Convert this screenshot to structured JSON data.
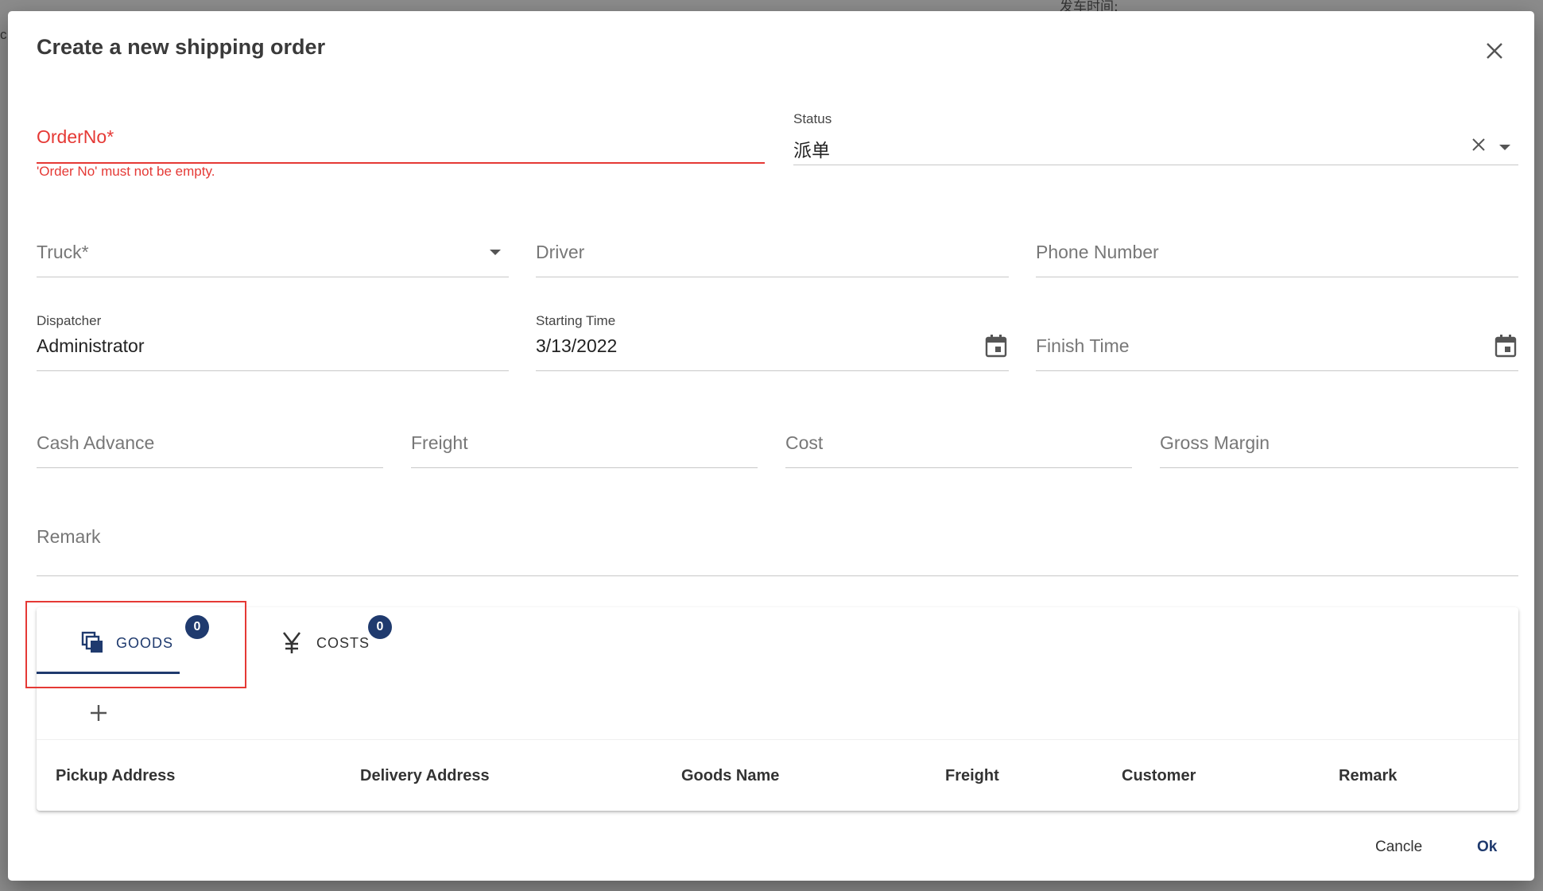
{
  "background": {
    "top_text": "发车时间:",
    "left_text": "c"
  },
  "dialog": {
    "title": "Create a new shipping order"
  },
  "form": {
    "order_no": {
      "label": "OrderNo*",
      "error": "'Order No' must not be empty."
    },
    "status": {
      "label": "Status",
      "value": "派单"
    },
    "truck": {
      "label": "Truck*"
    },
    "driver": {
      "label": "Driver"
    },
    "phone": {
      "label": "Phone Number"
    },
    "dispatcher": {
      "label": "Dispatcher",
      "value": "Administrator"
    },
    "starting_time": {
      "label": "Starting Time",
      "value": "3/13/2022"
    },
    "finish_time": {
      "label": "Finish Time"
    },
    "cash_advance": {
      "label": "Cash Advance"
    },
    "freight": {
      "label": "Freight"
    },
    "cost": {
      "label": "Cost"
    },
    "gross_margin": {
      "label": "Gross Margin"
    },
    "remark": {
      "label": "Remark"
    }
  },
  "tabs": [
    {
      "label": "GOODS",
      "badge": "0",
      "icon": "copy-icon",
      "active": true
    },
    {
      "label": "COSTS",
      "badge": "0",
      "icon": "yen-icon",
      "active": false
    }
  ],
  "table": {
    "columns": [
      "Pickup Address",
      "Delivery Address",
      "Goods Name",
      "Freight",
      "Customer",
      "Remark"
    ]
  },
  "footer": {
    "cancel": "Cancle",
    "ok": "Ok"
  },
  "colors": {
    "accent": "#1f3a6e",
    "error": "#e53935"
  }
}
